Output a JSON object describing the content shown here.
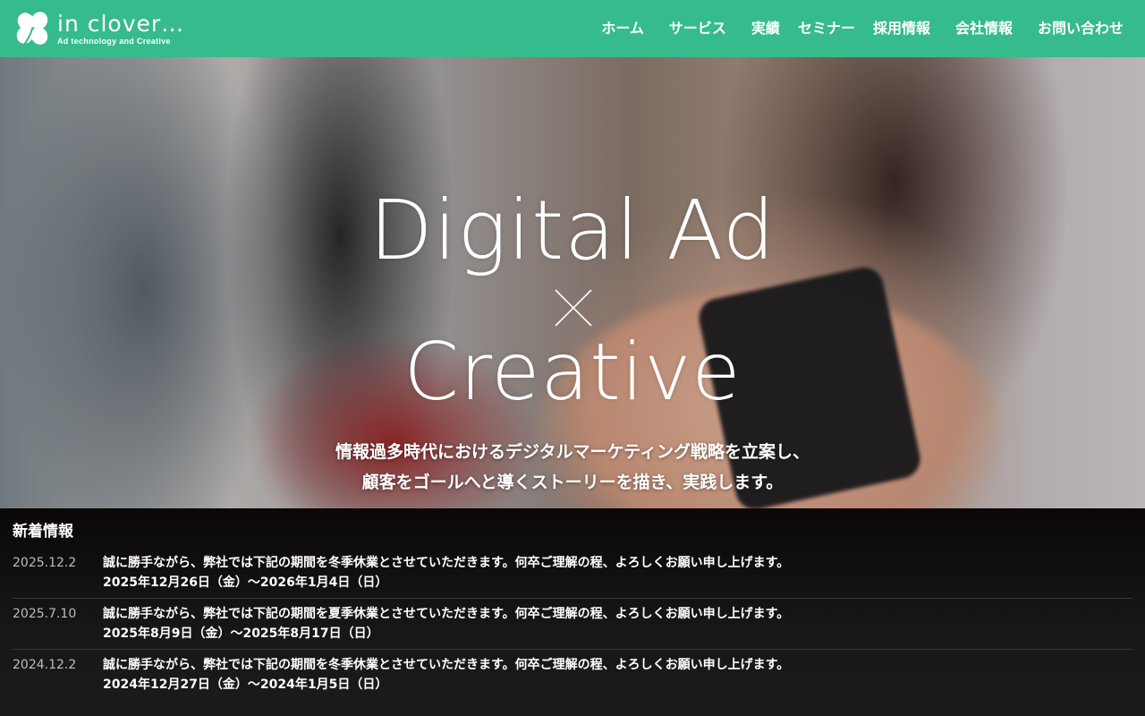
{
  "brand": {
    "name": "in clover…",
    "tagline": "Ad technology and Creative",
    "color": "#36bb8c"
  },
  "nav": {
    "items": [
      "ホーム",
      "サービス",
      "実績",
      "セミナー",
      "採用情報",
      "会社情報",
      "お問い合わせ"
    ]
  },
  "hero": {
    "line1": "Digital Ad",
    "cross_icon": "cross-icon",
    "line2": "Creative",
    "sub1": "情報過多時代におけるデジタルマーケティング戦略を立案し、",
    "sub2": "顧客をゴールへと導くストーリーを描き、実践します。"
  },
  "news": {
    "title": "新着情報",
    "items": [
      {
        "date": "2025.12.2",
        "line1": "誠に勝手ながら、弊社では下記の期間を冬季休業とさせていただきます。何卒ご理解の程、よろしくお願い申し上げます。",
        "line2": "2025年12月26日（金）～2026年1月4日（日）"
      },
      {
        "date": "2025.7.10",
        "line1": "誠に勝手ながら、弊社では下記の期間を夏季休業とさせていただきます。何卒ご理解の程、よろしくお願い申し上げます。",
        "line2": "2025年8月9日（金）～2025年8月17日（日）"
      },
      {
        "date": "2024.12.2",
        "line1": "誠に勝手ながら、弊社では下記の期間を冬季休業とさせていただきます。何卒ご理解の程、よろしくお願い申し上げます。",
        "line2": "2024年12月27日（金）～2024年1月5日（日）"
      }
    ]
  }
}
